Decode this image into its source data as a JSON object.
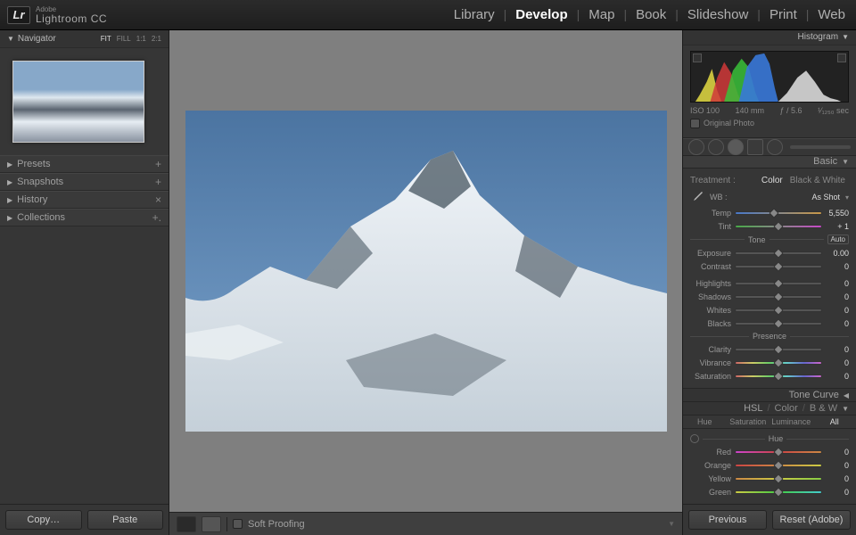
{
  "app": {
    "brand_small": "Adobe",
    "brand": "Lightroom CC",
    "logo": "Lr"
  },
  "modules": [
    "Library",
    "Develop",
    "Map",
    "Book",
    "Slideshow",
    "Print",
    "Web"
  ],
  "active_module": "Develop",
  "left": {
    "navigator_label": "Navigator",
    "zoom_modes": [
      "FIT",
      "FILL",
      "1:1",
      "2:1"
    ],
    "active_zoom": "FIT",
    "sections": [
      {
        "label": "Presets",
        "action": "+"
      },
      {
        "label": "Snapshots",
        "action": "+"
      },
      {
        "label": "History",
        "action": "×"
      },
      {
        "label": "Collections",
        "action": "+."
      }
    ],
    "buttons": {
      "copy": "Copy…",
      "paste": "Paste"
    }
  },
  "center": {
    "soft_proofing": "Soft Proofing"
  },
  "right": {
    "histogram_label": "Histogram",
    "meta": {
      "iso": "ISO 100",
      "focal": "140 mm",
      "aperture": "ƒ / 5.6",
      "shutter": "¹⁄₁₂₅₀ sec"
    },
    "original_photo": "Original Photo",
    "basic": {
      "title": "Basic",
      "treatment_label": "Treatment :",
      "color": "Color",
      "bw": "Black & White",
      "wb_label": "WB :",
      "wb_value": "As Shot",
      "temp": {
        "label": "Temp",
        "value": "5,550"
      },
      "tint": {
        "label": "Tint",
        "value": "+ 1"
      },
      "tone_label": "Tone",
      "auto": "Auto",
      "exposure": {
        "label": "Exposure",
        "value": "0.00"
      },
      "contrast": {
        "label": "Contrast",
        "value": "0"
      },
      "highlights": {
        "label": "Highlights",
        "value": "0"
      },
      "shadows": {
        "label": "Shadows",
        "value": "0"
      },
      "whites": {
        "label": "Whites",
        "value": "0"
      },
      "blacks": {
        "label": "Blacks",
        "value": "0"
      },
      "presence_label": "Presence",
      "clarity": {
        "label": "Clarity",
        "value": "0"
      },
      "vibrance": {
        "label": "Vibrance",
        "value": "0"
      },
      "saturation": {
        "label": "Saturation",
        "value": "0"
      }
    },
    "tone_curve": "Tone Curve",
    "hsl": {
      "title": "HSL",
      "color": "Color",
      "bw": "B & W",
      "tabs": [
        "Hue",
        "Saturation",
        "Luminance",
        "All"
      ],
      "active_tab": "All",
      "hue_label": "Hue",
      "rows": [
        {
          "label": "Red",
          "value": "0"
        },
        {
          "label": "Orange",
          "value": "0"
        },
        {
          "label": "Yellow",
          "value": "0"
        },
        {
          "label": "Green",
          "value": "0"
        }
      ]
    },
    "buttons": {
      "previous": "Previous",
      "reset": "Reset (Adobe)"
    }
  }
}
